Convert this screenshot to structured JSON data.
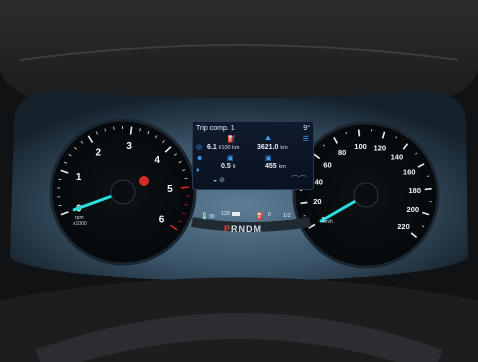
{
  "trip": {
    "title": "Trip comp. 1",
    "temp": "9°",
    "avg_consumption": "6.1",
    "avg_consumption_unit": "l/100 km",
    "range": "3621.0",
    "range_unit": "km",
    "fuel_used": "0.5",
    "fuel_used_unit": "lt",
    "distance": "455",
    "distance_unit": "km"
  },
  "tach": {
    "ticks": [
      "0",
      "1",
      "2",
      "3",
      "4",
      "5",
      "6"
    ],
    "unit_top": "rpm",
    "unit_bottom": "x1000",
    "value": 0
  },
  "speedo": {
    "ticks": [
      "0",
      "20",
      "40",
      "60",
      "80",
      "100",
      "120",
      "140",
      "160",
      "180",
      "200",
      "220"
    ],
    "unit": "km/h",
    "value": 0
  },
  "gauges": {
    "temp_low": "90",
    "temp_mid": "120",
    "fuel_empty": "0",
    "fuel_half": "1/2"
  },
  "gear": {
    "p": "P",
    "rest": "RNDM"
  },
  "colors": {
    "needle": "#29e0e0",
    "redzone": "#e02020",
    "screen_accent": "#3aa0ff"
  }
}
